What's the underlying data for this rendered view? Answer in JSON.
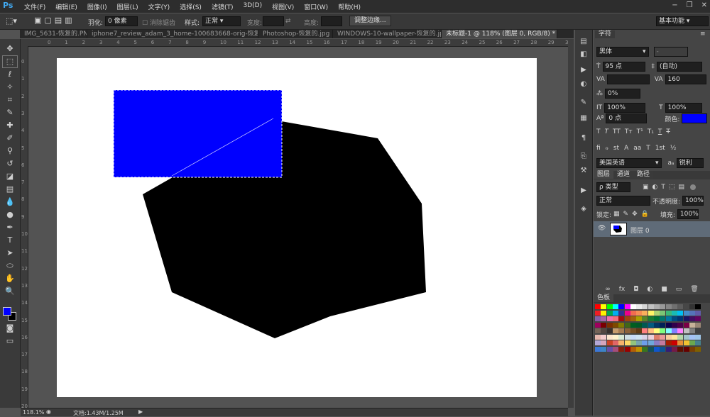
{
  "app": {
    "logo": "Ps"
  },
  "menu": [
    "文件(F)",
    "编辑(E)",
    "图像(I)",
    "图层(L)",
    "文字(Y)",
    "选择(S)",
    "滤镜(T)",
    "3D(D)",
    "视图(V)",
    "窗口(W)",
    "帮助(H)"
  ],
  "window_controls": {
    "minimize": "−",
    "restore": "❐",
    "close": "✕"
  },
  "options_bar": {
    "feather_label": "羽化:",
    "feather_value": "0 像素",
    "antialias_label": "消除锯齿",
    "style_label": "样式:",
    "style_value": "正常",
    "width_label": "宽度:",
    "height_label": "高度:",
    "refine_button": "调整边缘...",
    "workspace": "基本功能"
  },
  "tabs": [
    {
      "label": "IMG_5631-恢复的.PNG",
      "close": "×",
      "active": false
    },
    {
      "label": "iphone7_review_adam_3_home-100683668-orig-恢复的.jpg",
      "close": "×",
      "active": false
    },
    {
      "label": "Photoshop-恢复的.jpg",
      "close": "×",
      "active": false
    },
    {
      "label": "WINDOWS-10-wallpaper-恢复的.jpg",
      "close": "×",
      "active": false
    },
    {
      "label": "未标题-1 @ 118% (图层 0, RGB/8) *",
      "close": "×",
      "active": true
    }
  ],
  "ruler_h": [
    "0",
    "1",
    "2",
    "3",
    "4",
    "5",
    "6",
    "7",
    "8",
    "9",
    "10",
    "11",
    "12",
    "13",
    "14",
    "15",
    "16",
    "17",
    "18",
    "19",
    "20",
    "21",
    "22",
    "23",
    "24",
    "25",
    "26",
    "27",
    "28",
    "29",
    "30",
    "31"
  ],
  "ruler_v": [
    "0",
    "1",
    "2",
    "3",
    "4",
    "5",
    "6",
    "7",
    "8",
    "9",
    "10",
    "11",
    "12",
    "13",
    "14",
    "15",
    "16",
    "17",
    "18",
    "19",
    "20"
  ],
  "status": {
    "zoom": "118.1%",
    "doc": "文档:1.43M/1.25M"
  },
  "character_panel": {
    "tab": "字符",
    "font_family": "黑体",
    "font_style": "-",
    "font_size": "95 点",
    "leading": "(自动)",
    "kerning": "",
    "tracking": "160",
    "scale_label": "0%",
    "vertical_scale": "100%",
    "horizontal_scale": "100%",
    "baseline": "0 点",
    "color_label": "颜色:",
    "style_buttons": [
      "T",
      "T",
      "TT",
      "Tт",
      "T¹",
      "T₁",
      "T",
      "T"
    ],
    "opentype_buttons": [
      "fi",
      "ℴ",
      "st",
      "A",
      "aa",
      "T",
      "1st",
      "½"
    ],
    "language": "美国英语",
    "antialias": "锐利"
  },
  "layers_panel": {
    "tabs": [
      "图层",
      "通道",
      "路径"
    ],
    "filter": "ρ 类型",
    "blend_mode": "正常",
    "opacity_label": "不透明度:",
    "opacity": "100%",
    "lock_label": "锁定:",
    "fill_label": "填充:",
    "fill": "100%",
    "layer_name": "图层 0",
    "footer_icons": [
      "∞",
      "fx",
      "◘",
      "◐",
      "■",
      "▭",
      "🗑"
    ]
  },
  "swatches_panel": {
    "tab": "色板"
  },
  "colors": {
    "foreground": "#0000ff",
    "background": "#000000",
    "selection_fill": "#0000ff",
    "shape_fill": "#000000",
    "text_color": "#0000ff"
  },
  "toolbar_icons": [
    "move-icon",
    "marquee-icon",
    "lasso-icon",
    "magic-wand-icon",
    "crop-icon",
    "eyedropper-icon",
    "healing-icon",
    "brush-icon",
    "stamp-icon",
    "history-brush-icon",
    "eraser-icon",
    "gradient-icon",
    "blur-icon",
    "dodge-icon",
    "pen-icon",
    "type-icon",
    "path-select-icon",
    "shape-icon",
    "hand-icon",
    "zoom-icon"
  ]
}
